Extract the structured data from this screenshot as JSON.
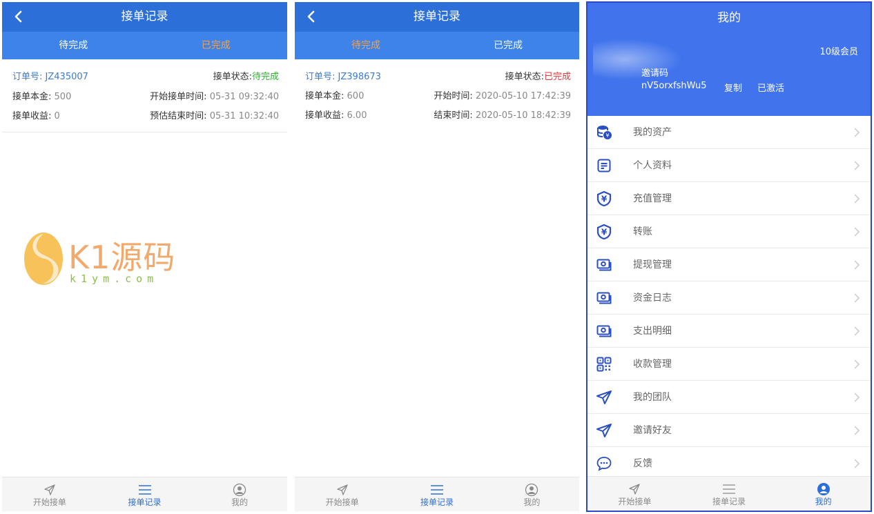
{
  "screens": {
    "p1": {
      "title": "接单记录",
      "tabs": [
        "待完成",
        "已完成"
      ],
      "order": {
        "id_label": "订单号:",
        "id": "JZ435007",
        "status_label": "接单状态:",
        "status": "待完成",
        "principal_label": "接单本金:",
        "principal": "500",
        "start_label": "开始接单时间:",
        "start": "05-31 09:32:40",
        "income_label": "接单收益:",
        "income": "0",
        "end_label": "预估结束时间:",
        "end": "05-31 10:32:40"
      }
    },
    "p2": {
      "title": "接单记录",
      "tabs": [
        "待完成",
        "已完成"
      ],
      "order": {
        "id_label": "订单号:",
        "id": "JZ398673",
        "status_label": "接单状态:",
        "status": "已完成",
        "principal_label": "接单本金:",
        "principal": "600",
        "start_label": "开始时间:",
        "start": "2020-05-10 17:42:39",
        "income_label": "接单收益:",
        "income": "6.00",
        "end_label": "结束时间:",
        "end": "2020-05-10 18:42:39"
      }
    },
    "p3": {
      "title": "我的",
      "level": "10级会员",
      "invite_label": "邀请码",
      "invite_code": "nV5orxfshWu5",
      "copy": "复制",
      "activated": "已激活",
      "menu": [
        {
          "label": "我的资产",
          "icon": "coins-icon"
        },
        {
          "label": "个人资料",
          "icon": "document-icon"
        },
        {
          "label": "充值管理",
          "icon": "yuan-shield-icon"
        },
        {
          "label": "转账",
          "icon": "yuan-shield-icon"
        },
        {
          "label": "提现管理",
          "icon": "cash-icon"
        },
        {
          "label": "资金日志",
          "icon": "cash-icon"
        },
        {
          "label": "支出明细",
          "icon": "cash-icon"
        },
        {
          "label": "收款管理",
          "icon": "qrcode-icon"
        },
        {
          "label": "我的团队",
          "icon": "paper-plane-icon"
        },
        {
          "label": "邀请好友",
          "icon": "paper-plane-icon"
        },
        {
          "label": "反馈",
          "icon": "chat-bubble-icon"
        }
      ]
    }
  },
  "bottom_nav": [
    "开始接单",
    "接单记录",
    "我的"
  ],
  "watermark": {
    "brand": "K1源码",
    "url": "k1ym.com"
  },
  "colors": {
    "nav_blue": "#2d6fd8",
    "tab_blue": "#3e83e9",
    "header_blue": "#4073ec",
    "active_orange": "#f6a247",
    "status_green": "#31b031",
    "status_red": "#e33b3b"
  }
}
